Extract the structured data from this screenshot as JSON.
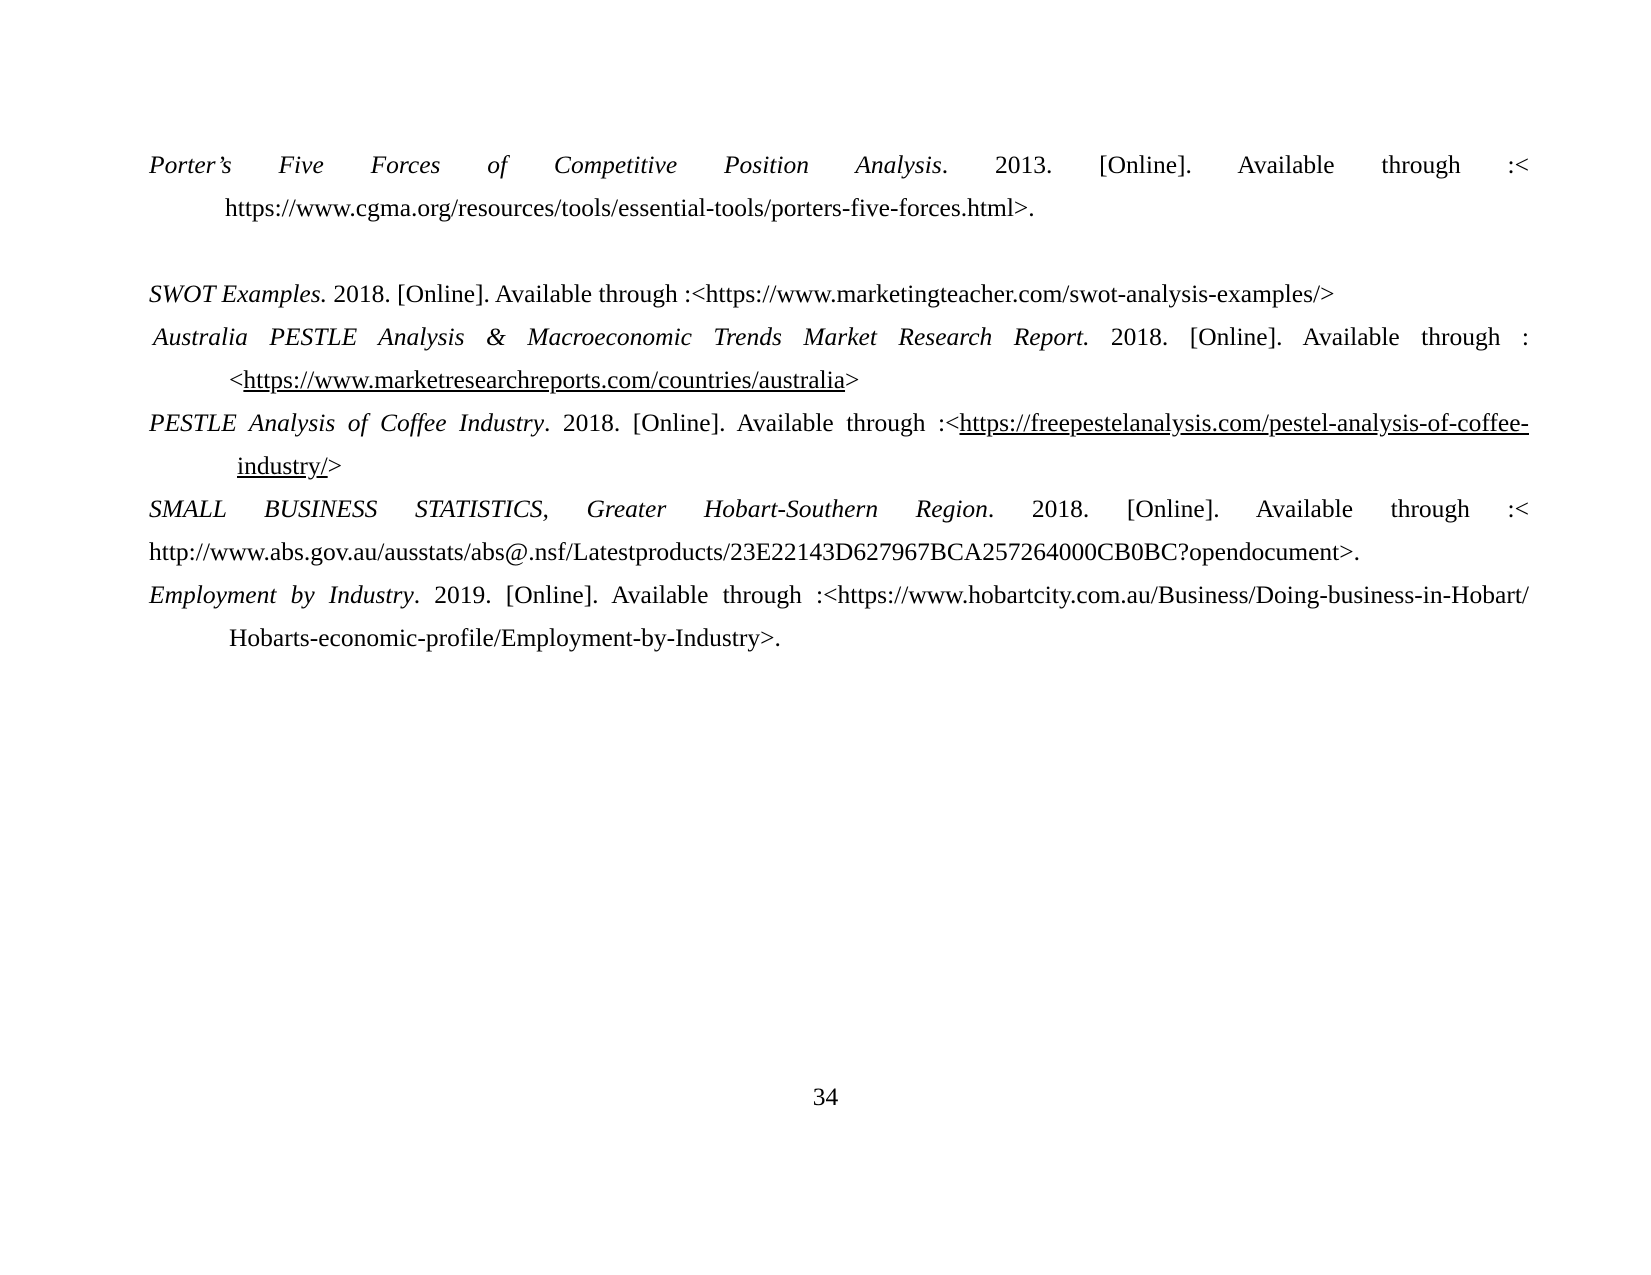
{
  "document": {
    "type": "references-page",
    "page_number": "34",
    "background_color": "#ffffff",
    "text_color": "#000000"
  },
  "references": [
    {
      "id": "porters-five-forces",
      "title": "Porter’s Five Forces of Competitive Position Analysis",
      "title_italic": true,
      "year": "2013.",
      "availability": "[Online]. Available through :<",
      "url": "https://www.cgma.org/resources/tools/essential-tools/porters-five-forces.html",
      "url_underlined": false,
      "url_suffix": ">.",
      "justified": true
    },
    {
      "id": "swot-examples",
      "title": "SWOT Examples.",
      "title_italic": true,
      "year": "2018.",
      "availability": "[Online]. Available through :<",
      "url": "https://www.marketingteacher.com/swot-analysis-examples/",
      "url_underlined": false,
      "url_suffix": ">",
      "justified": false
    },
    {
      "id": "australia-pestle",
      "title": "Australia PESTLE Analysis & Macroeconomic Trends Market Research Report.",
      "title_italic": true,
      "year": "2018.",
      "availability": "[Online]. Available through :<",
      "url": "https://www.marketresearchreports.com/countries/australia",
      "url_underlined": true,
      "url_suffix": ">",
      "justified": true
    },
    {
      "id": "pestle-coffee-industry",
      "title": "PESTLE Analysis of Coffee Industry",
      "title_italic": true,
      "title_suffix": ".",
      "year": "2018.",
      "availability": "[Online]. Available through :<",
      "url": "https://freepestelanalysis.com/pestel-analysis-of-coffee-industry/",
      "url_underlined": true,
      "url_suffix": ">",
      "justified": true
    },
    {
      "id": "small-business-statistics",
      "title": "SMALL BUSINESS STATISTICS, Greater Hobart-Southern Region",
      "title_italic": true,
      "title_suffix": ".",
      "year": "2018.",
      "availability": "[Online]. Available through :<",
      "url": "http://www.abs.gov.au/ausstats/abs@.nsf/Latestproducts/23E22143D627967BCA257264000CB0BC?opendocument",
      "url_underlined": false,
      "url_suffix": ">.",
      "justified": true
    },
    {
      "id": "employment-by-industry",
      "title": "Employment by Industry",
      "title_italic": true,
      "title_suffix": ".",
      "year": "2019.",
      "availability": "[Online]. Available through :<",
      "url": "https://www.hobartcity.com.au/Business/Doing-business-in-Hobart/ Hobarts-economic-profile/Employment-by-Industry",
      "url_underlined": false,
      "url_suffix": ">.",
      "justified": true
    }
  ],
  "line_fragments": {
    "ref1_line1_title": "Porter’s Five Forces of Competitive Position Analysis",
    "ref1_line1_rest": ". 2013. [Online]. Available through :<",
    "ref1_line2": "https://www.cgma.org/resources/tools/essential-tools/porters-five-forces.html>.",
    "ref2_title": "SWOT Examples.",
    "ref2_rest": " 2018. [Online]. Available through :<https://www.marketingteacher.com/swot-analysis-examples/>",
    "ref3_title": "Australia PESTLE Analysis & Macroeconomic Trends Market Research Report.",
    "ref3_mid": " 2018. [Online]. Available",
    "ref3_line2_lead": "through :<",
    "ref3_line2_url": "https://www.marketresearchreports.com/countries/australia",
    "ref3_line2_tail": ">",
    "ref4_title": "PESTLE Analysis of Coffee Industry",
    "ref4_mid": ". 2018. [Online]. Available through :<",
    "ref4_url_part1": "https://freepestelanalysis.com/pestel-analysis-of-coffee-",
    "ref4_url_part2": "industry/",
    "ref4_tail": ">",
    "ref5_title": "SMALL BUSINESS STATISTICS, Greater Hobart-Southern Region",
    "ref5_mid": ". 2018. [Online]. Available through :<",
    "ref5_line2": "http://www.abs.gov.au/ausstats/abs@.nsf/Latestproducts/23E22143D627967BCA257264000CB0BC?opendocument>.",
    "ref6_title": "Employment by Industry",
    "ref6_mid": ". 2019. [Online]. Available through :<https://www.hobartcity.com.au/Business/Doing-business-in-Hobart/",
    "ref6_line2": "Hobarts-economic-profile/Employment-by-Industry>."
  },
  "footer": {
    "page_number": "34"
  }
}
